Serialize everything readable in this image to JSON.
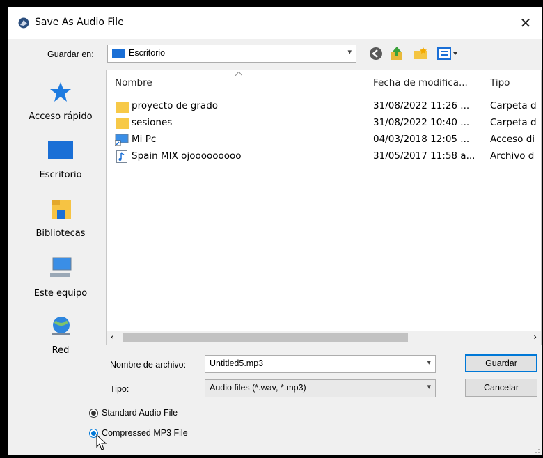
{
  "window": {
    "title": "Save As Audio File",
    "close_glyph": "✕"
  },
  "toolbar": {
    "save_in_label": "Guardar en:",
    "save_in_value": "Escritorio",
    "icons": [
      "back-icon",
      "up-folder-icon",
      "new-folder-icon",
      "view-menu-icon"
    ]
  },
  "places": [
    {
      "label": "Acceso rápido",
      "icon": "star-icon"
    },
    {
      "label": "Escritorio",
      "icon": "desktop-icon"
    },
    {
      "label": "Bibliotecas",
      "icon": "libraries-icon"
    },
    {
      "label": "Este equipo",
      "icon": "computer-icon"
    },
    {
      "label": "Red",
      "icon": "network-icon"
    }
  ],
  "filelist": {
    "columns": [
      "Nombre",
      "Fecha de modifica...",
      "Tipo"
    ],
    "rows": [
      {
        "name": "proyecto de grado",
        "date": "31/08/2022 11:26 ...",
        "type": "Carpeta d",
        "icon": "folder-icon"
      },
      {
        "name": "sesiones",
        "date": "31/08/2022 10:40 ...",
        "type": "Carpeta d",
        "icon": "folder-icon"
      },
      {
        "name": "Mi Pc",
        "date": "04/03/2018 12:05 ...",
        "type": "Acceso di",
        "icon": "shortcut-icon"
      },
      {
        "name": "Spain MIX ojooooooooo",
        "date": "31/05/2017 11:58 a...",
        "type": "Archivo d",
        "icon": "audio-file-icon"
      }
    ]
  },
  "form": {
    "filename_label": "Nombre de archivo:",
    "filename_value": "Untitled5.mp3",
    "type_label": "Tipo:",
    "type_value": "Audio files (*.wav, *.mp3)",
    "save_button": "Guardar",
    "cancel_button": "Cancelar"
  },
  "options": {
    "standard_label": "Standard Audio File",
    "compressed_label": "Compressed MP3 File"
  },
  "colors": {
    "accent": "#0078d7",
    "folder": "#f7c948"
  }
}
